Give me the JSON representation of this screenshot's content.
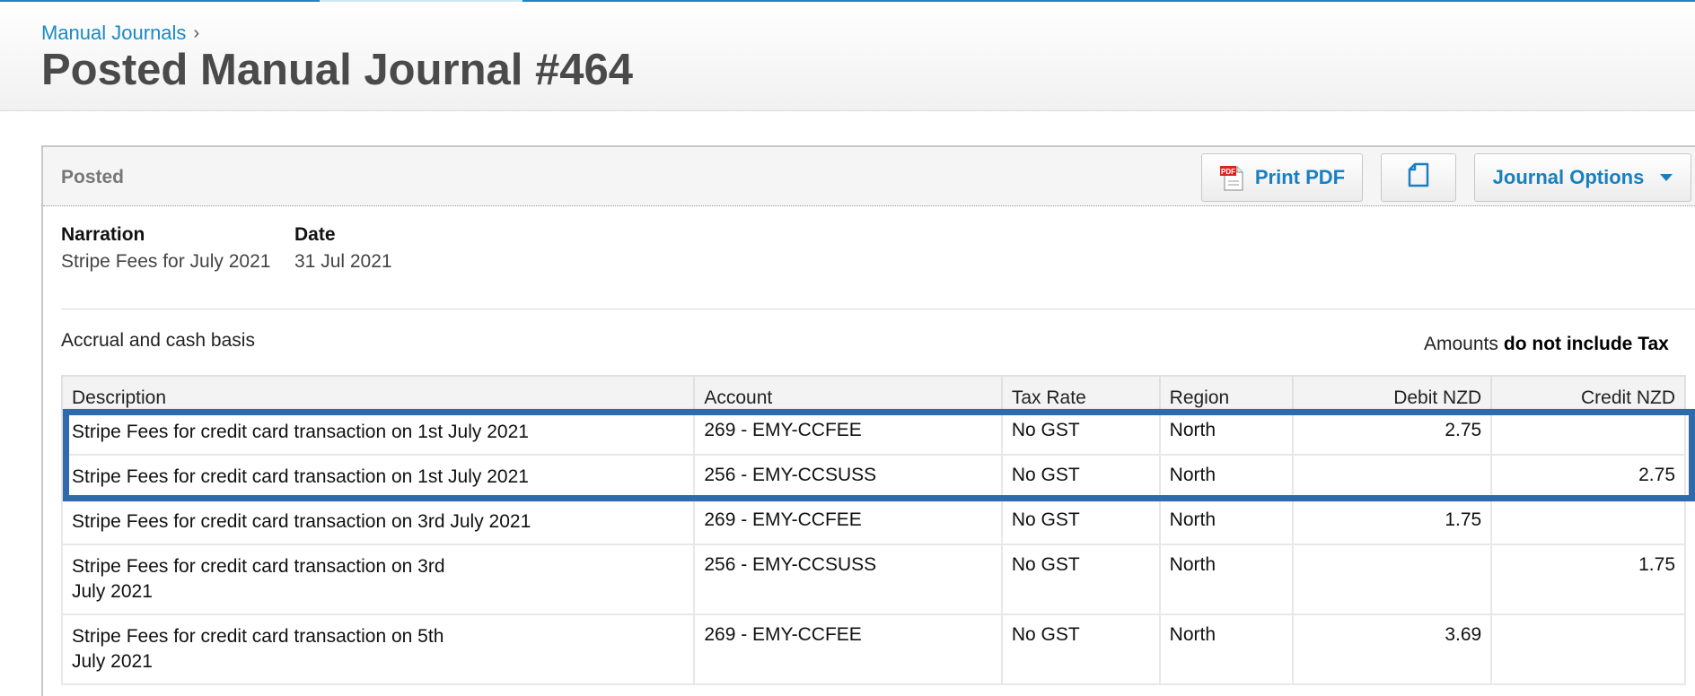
{
  "breadcrumb": {
    "link": "Manual Journals",
    "separator": "›"
  },
  "page_title": "Posted Manual Journal #464",
  "panel": {
    "status": "Posted",
    "buttons": {
      "print_pdf": "Print PDF",
      "journal_options": "Journal Options"
    },
    "narration": {
      "label": "Narration",
      "value": "Stripe Fees for July 2021"
    },
    "date": {
      "label": "Date",
      "value": "31 Jul 2021"
    },
    "basis": "Accrual and cash basis",
    "tax_note": {
      "prefix": "Amounts",
      "emphasis": "do not include Tax"
    }
  },
  "table": {
    "headers": [
      "Description",
      "Account",
      "Tax Rate",
      "Region",
      "Debit NZD",
      "Credit NZD"
    ],
    "rows": [
      {
        "description": "Stripe Fees for credit card transaction on 1st July 2021",
        "account": "269 - EMY-CCFEE",
        "tax_rate": "No GST",
        "region": "North",
        "debit": "2.75",
        "credit": ""
      },
      {
        "description": "Stripe Fees for credit card transaction on 1st July 2021",
        "account": "256 - EMY-CCSUSS",
        "tax_rate": "No GST",
        "region": "North",
        "debit": "",
        "credit": "2.75"
      },
      {
        "description": "Stripe Fees for credit card transaction on 3rd July 2021",
        "account": "269 - EMY-CCFEE",
        "tax_rate": "No GST",
        "region": "North",
        "debit": "1.75",
        "credit": ""
      },
      {
        "description": "Stripe Fees for credit card transaction on 3rd July 2021",
        "account": "256 - EMY-CCSUSS",
        "tax_rate": "No GST",
        "region": "North",
        "debit": "",
        "credit": "1.75"
      },
      {
        "description": "Stripe Fees for credit card transaction on 5th July 2021",
        "account": "269 - EMY-CCFEE",
        "tax_rate": "No GST",
        "region": "North",
        "debit": "3.69",
        "credit": ""
      }
    ]
  },
  "colors": {
    "link": "#1a8ac4",
    "button_text": "#1a7fc0",
    "highlight": "#2f6aad",
    "pdf_red": "#d9261c"
  },
  "icons": {
    "pdf": "pdf-file-icon",
    "copy": "copy-document-icon",
    "dropdown": "caret-down-icon"
  }
}
